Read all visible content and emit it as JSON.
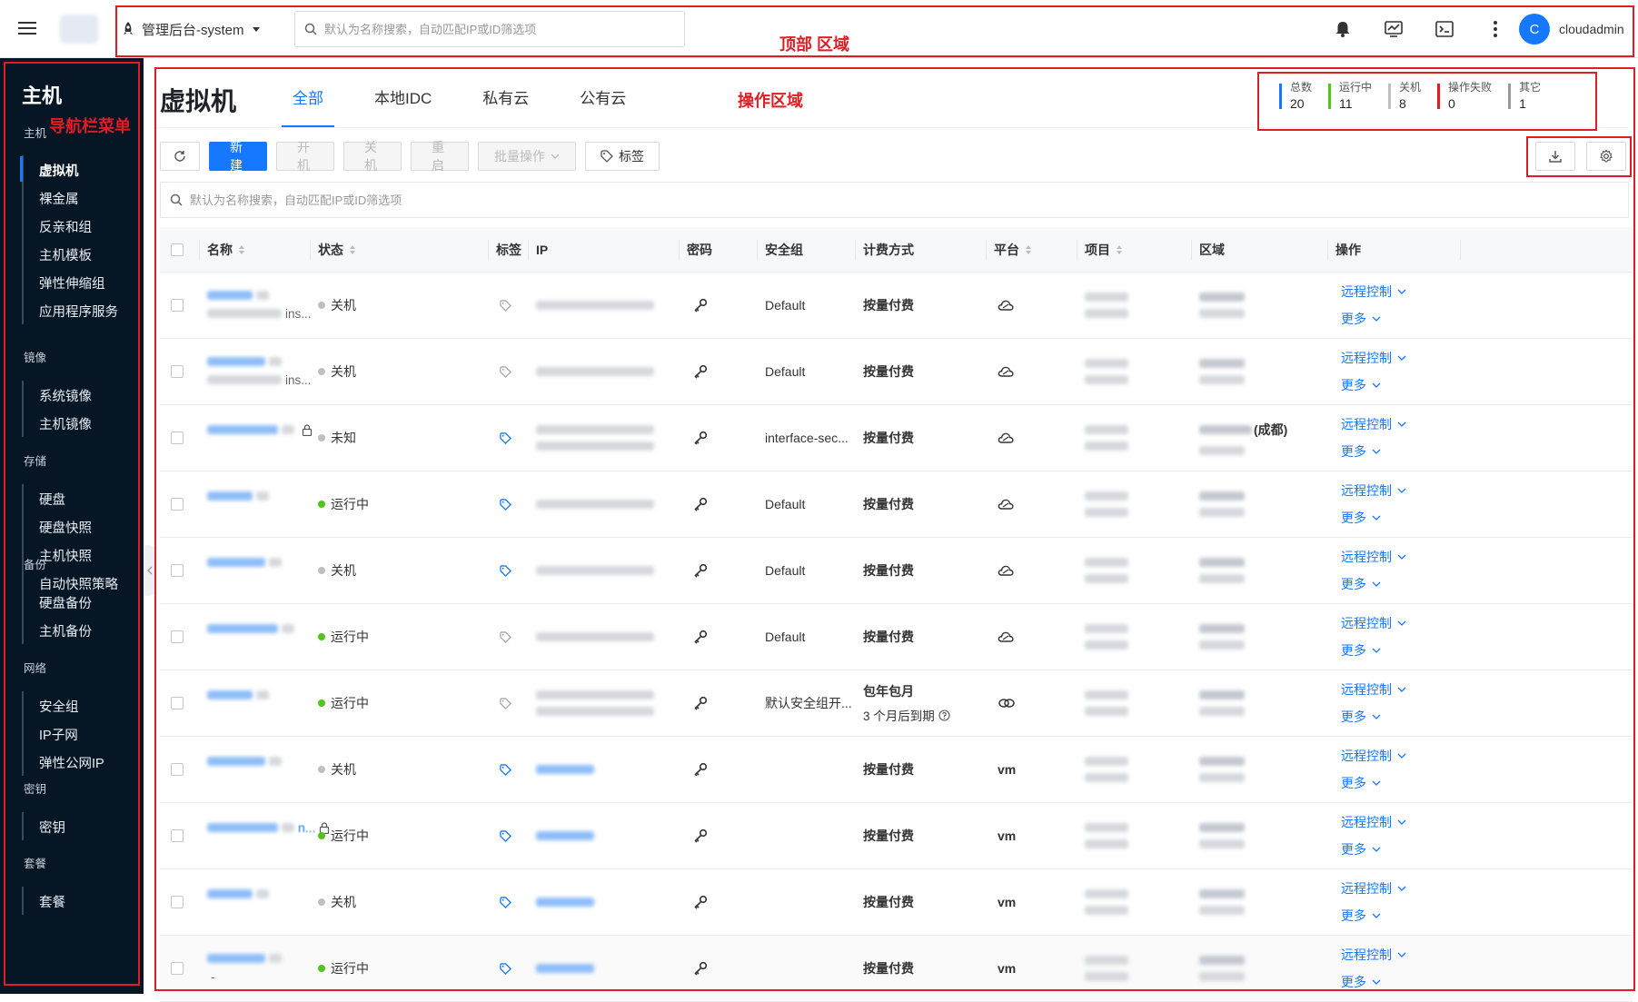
{
  "topbar": {
    "project_label": "管理后台-system",
    "search_placeholder": "默认为名称搜索，自动匹配IP或ID筛选项",
    "user_initial": "C",
    "user_name": "cloudadmin",
    "annotation_top": "顶部 区域"
  },
  "sidebar": {
    "title": "主机",
    "annotation": "导航栏菜单",
    "groups": [
      {
        "label": "主机",
        "items": [
          "虚拟机",
          "裸金属",
          "反亲和组",
          "主机模板",
          "弹性伸缩组",
          "应用程序服务"
        ]
      },
      {
        "label": "镜像",
        "items": [
          "系统镜像",
          "主机镜像"
        ]
      },
      {
        "label": "存储",
        "items": [
          "硬盘",
          "硬盘快照",
          "主机快照",
          "自动快照策略"
        ]
      },
      {
        "label": "备份",
        "items": [
          "硬盘备份",
          "主机备份"
        ]
      },
      {
        "label": "网络",
        "items": [
          "安全组",
          "IP子网",
          "弹性公网IP"
        ]
      },
      {
        "label": "密钥",
        "items": [
          "密钥"
        ]
      },
      {
        "label": "套餐",
        "items": [
          "套餐"
        ]
      }
    ],
    "active_item": "虚拟机"
  },
  "main": {
    "title": "虚拟机",
    "annotation": "操作区域",
    "tabs": [
      "全部",
      "本地IDC",
      "私有云",
      "公有云"
    ],
    "active_tab": "全部",
    "stats": [
      {
        "label": "总数",
        "value": "20",
        "color": "#1677ff"
      },
      {
        "label": "运行中",
        "value": "11",
        "color": "#52c41a"
      },
      {
        "label": "关机",
        "value": "8",
        "color": "#bfbfbf"
      },
      {
        "label": "操作失败",
        "value": "0",
        "color": "#e01d24"
      },
      {
        "label": "其它",
        "value": "1",
        "color": "#999999"
      }
    ],
    "toolbar": {
      "refresh": "refresh-icon",
      "new": "新建",
      "start": "开机",
      "stop": "关机",
      "restart": "重启",
      "batch": "批量操作",
      "tag": "标签"
    },
    "table_search_placeholder": "默认为名称搜索，自动匹配IP或ID筛选项",
    "columns": [
      "名称",
      "状态",
      "标签",
      "IP",
      "密码",
      "安全组",
      "计费方式",
      "平台",
      "项目",
      "区域",
      "操作"
    ],
    "rows": [
      {
        "name_suffix": "",
        "sub": "ins...",
        "status": "关机",
        "status_color": "#bfbfbf",
        "tag_blue": false,
        "ip_link": false,
        "secgroup": "Default",
        "billing": "按量付费",
        "billing_sub": "",
        "platform": "cloud",
        "platform_text": "",
        "region_extra": "",
        "lock": false
      },
      {
        "name_suffix": "",
        "sub": "ins...",
        "status": "关机",
        "status_color": "#bfbfbf",
        "tag_blue": false,
        "ip_link": false,
        "secgroup": "Default",
        "billing": "按量付费",
        "billing_sub": "",
        "platform": "cloud",
        "platform_text": "",
        "region_extra": "",
        "lock": false
      },
      {
        "name_suffix": "",
        "sub": "",
        "status": "未知",
        "status_color": "#bfbfbf",
        "tag_blue": true,
        "ip_link": false,
        "secgroup": "interface-sec...",
        "billing": "按量付费",
        "billing_sub": "",
        "platform": "cloud",
        "platform_text": "",
        "region_extra": "(成都)",
        "lock": true
      },
      {
        "name_suffix": "",
        "sub": "",
        "status": "运行中",
        "status_color": "#52c41a",
        "tag_blue": true,
        "ip_link": false,
        "secgroup": "Default",
        "billing": "按量付费",
        "billing_sub": "",
        "platform": "cloud",
        "platform_text": "",
        "region_extra": "",
        "lock": false
      },
      {
        "name_suffix": "",
        "sub": "",
        "status": "关机",
        "status_color": "#bfbfbf",
        "tag_blue": true,
        "ip_link": false,
        "secgroup": "Default",
        "billing": "按量付费",
        "billing_sub": "",
        "platform": "cloud",
        "platform_text": "",
        "region_extra": "",
        "lock": false
      },
      {
        "name_suffix": "",
        "sub": "",
        "status": "运行中",
        "status_color": "#52c41a",
        "tag_blue": false,
        "ip_link": false,
        "secgroup": "Default",
        "billing": "按量付费",
        "billing_sub": "",
        "platform": "cloud",
        "platform_text": "",
        "region_extra": "",
        "lock": false
      },
      {
        "name_suffix": "",
        "sub": "",
        "status": "运行中",
        "status_color": "#52c41a",
        "tag_blue": false,
        "ip_link": false,
        "secgroup": "默认安全组开...",
        "billing": "包年包月",
        "billing_sub": "3 个月后到期",
        "platform": "link",
        "platform_text": "",
        "region_extra": "",
        "lock": false
      },
      {
        "name_suffix": "",
        "sub": "",
        "status": "关机",
        "status_color": "#bfbfbf",
        "tag_blue": true,
        "ip_link": true,
        "secgroup": "",
        "billing": "按量付费",
        "billing_sub": "",
        "platform": "vm",
        "platform_text": "vm",
        "region_extra": "",
        "lock": false
      },
      {
        "name_suffix": "n...",
        "sub": "",
        "status": "运行中",
        "status_color": "#52c41a",
        "tag_blue": true,
        "ip_link": true,
        "secgroup": "",
        "billing": "按量付费",
        "billing_sub": "",
        "platform": "vm",
        "platform_text": "vm",
        "region_extra": "",
        "lock": true
      },
      {
        "name_suffix": "",
        "sub": "",
        "status": "关机",
        "status_color": "#bfbfbf",
        "tag_blue": true,
        "ip_link": true,
        "secgroup": "",
        "billing": "按量付费",
        "billing_sub": "",
        "platform": "vm",
        "platform_text": "vm",
        "region_extra": "",
        "lock": false
      },
      {
        "name_suffix": "",
        "sub": "-",
        "status": "运行中",
        "status_color": "#52c41a",
        "tag_blue": true,
        "ip_link": true,
        "secgroup": "",
        "billing": "按量付费",
        "billing_sub": "",
        "platform": "vm",
        "platform_text": "vm",
        "region_extra": "",
        "lock": false
      }
    ],
    "op_remote": "远程控制",
    "op_more": "更多"
  },
  "colors": {
    "accent": "#1677ff",
    "sidebar_bg": "#061625",
    "annotation": "#e01d24"
  }
}
